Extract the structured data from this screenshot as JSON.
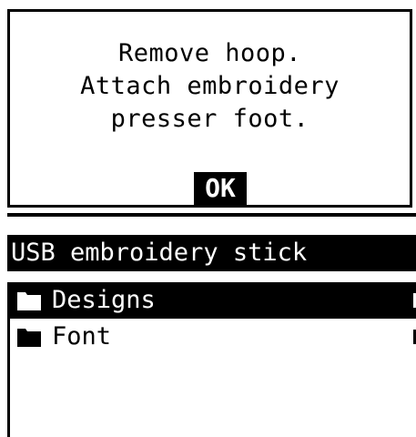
{
  "dialog": {
    "lines": [
      "Remove hoop.",
      "Attach embroidery",
      "presser foot."
    ],
    "ok_label": "OK"
  },
  "browser": {
    "title": "USB embroidery stick",
    "items": [
      {
        "label": "Designs",
        "icon": "folder-icon",
        "selected": true
      },
      {
        "label": "Font",
        "icon": "folder-icon",
        "selected": false
      }
    ]
  }
}
